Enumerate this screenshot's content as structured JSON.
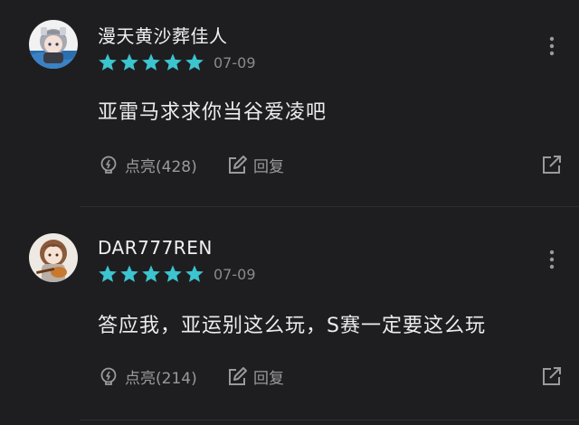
{
  "comments": [
    {
      "username": "漫天黄沙葬佳人",
      "rating": 5,
      "date": "07-09",
      "content": "亚雷马求求你当谷爱凌吧",
      "like_label": "点亮(428)",
      "reply_label": "回复",
      "avatar_icon": "anime-avatar-gray-hair"
    },
    {
      "username": "DAR777REN",
      "rating": 5,
      "date": "07-09",
      "content": "答应我，亚运别这么玩，S赛一定要这么玩",
      "like_label": "点亮(214)",
      "reply_label": "回复",
      "avatar_icon": "anime-avatar-guitar"
    }
  ],
  "colors": {
    "background": "#1e1e20",
    "star": "#3cc4cf",
    "muted": "#9a9a9e"
  },
  "icons": {
    "like": "lightbulb-icon",
    "reply": "edit-reply-icon",
    "share": "share-out-icon",
    "more": "more-vertical-icon"
  }
}
